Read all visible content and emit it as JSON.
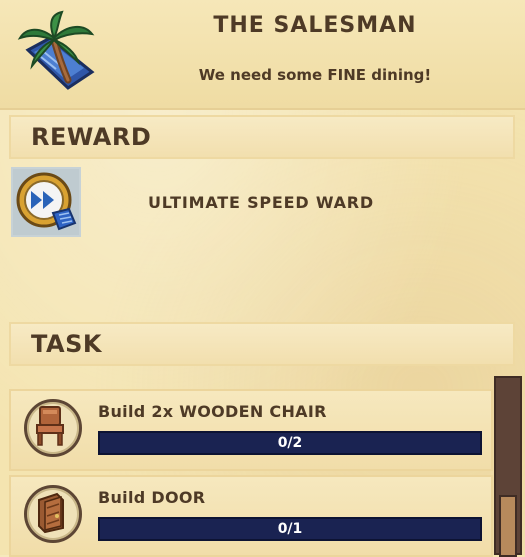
{
  "quest": {
    "title": "THE SALESMAN",
    "description": "We need some FINE dining!",
    "icon": "palm-tree-island-icon"
  },
  "reward": {
    "heading": "REWARD",
    "item_name": "ULTIMATE SPEED WARD",
    "icon": "speed-ward-icon"
  },
  "task": {
    "heading": "TASK",
    "items": [
      {
        "label": "Build 2x WOODEN CHAIR",
        "progress_text": "0/2",
        "progress": 0,
        "icon": "wooden-chair-icon"
      },
      {
        "label": "Build DOOR",
        "progress_text": "0/1",
        "progress": 0,
        "icon": "wooden-door-icon"
      }
    ]
  },
  "colors": {
    "parchment": "#f4e4b0",
    "text": "#4e3a26",
    "progress_track": "#1a2352",
    "scrollbar": "#5d4337"
  }
}
